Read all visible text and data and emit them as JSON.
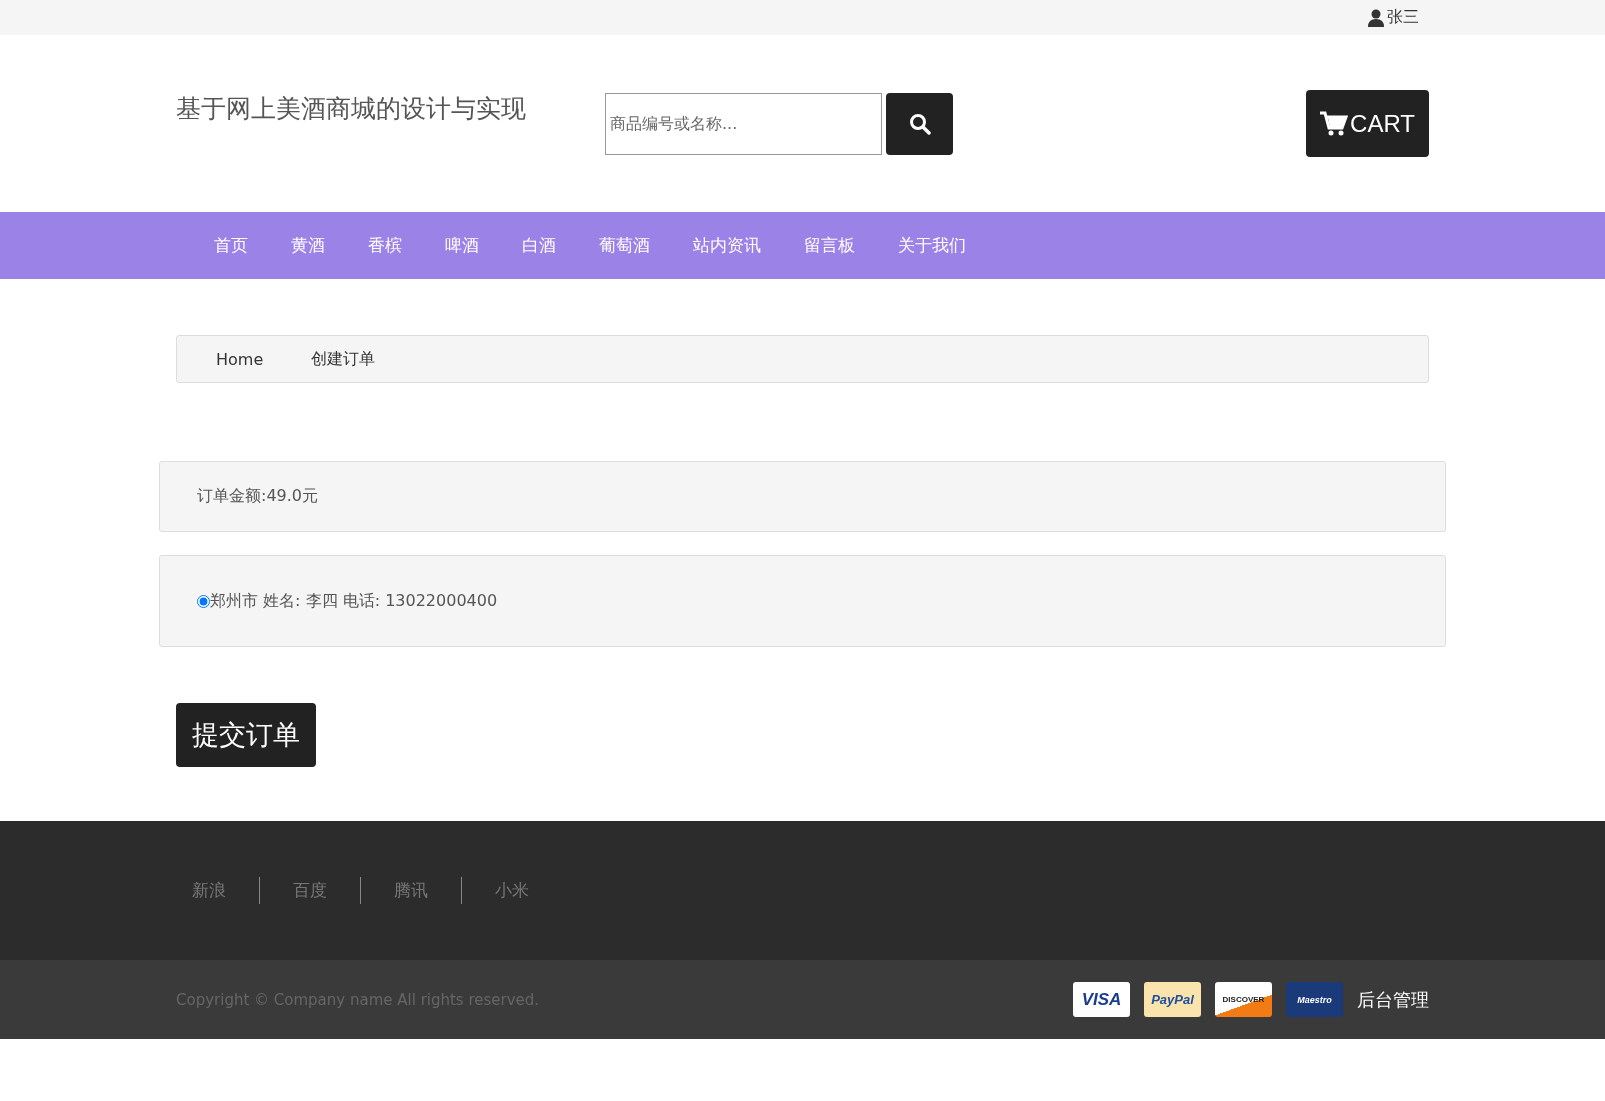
{
  "top_bar": {
    "user": "张三"
  },
  "header": {
    "title": "基于网上美酒商城的设计与实现",
    "search": {
      "placeholder": "商品编号或名称..."
    },
    "cart": "CART"
  },
  "nav": [
    "首页",
    "黄酒",
    "香槟",
    "啤酒",
    "白酒",
    "葡萄酒",
    "站内资讯",
    "留言板",
    "关于我们"
  ],
  "breadcrumb": [
    "Home",
    "创建订单"
  ],
  "order": {
    "amount": "订单金额:49.0元",
    "addresses": [
      {
        "label": "郑州市 姓名: 李四 电话: 13022000400",
        "selected": true
      }
    ],
    "submit": "提交订单"
  },
  "footer": {
    "links": [
      "新浪",
      "百度",
      "腾讯",
      "小米"
    ],
    "copyright": "Copyright © Company name All rights reserved.",
    "payment_logos": [
      {
        "kind": "visa",
        "text": "VISA"
      },
      {
        "kind": "paypal",
        "text": "PayPal"
      },
      {
        "kind": "discover",
        "text": "DISCOVER"
      },
      {
        "kind": "maestro",
        "text": "Maestro"
      }
    ],
    "admin": "后台管理"
  }
}
